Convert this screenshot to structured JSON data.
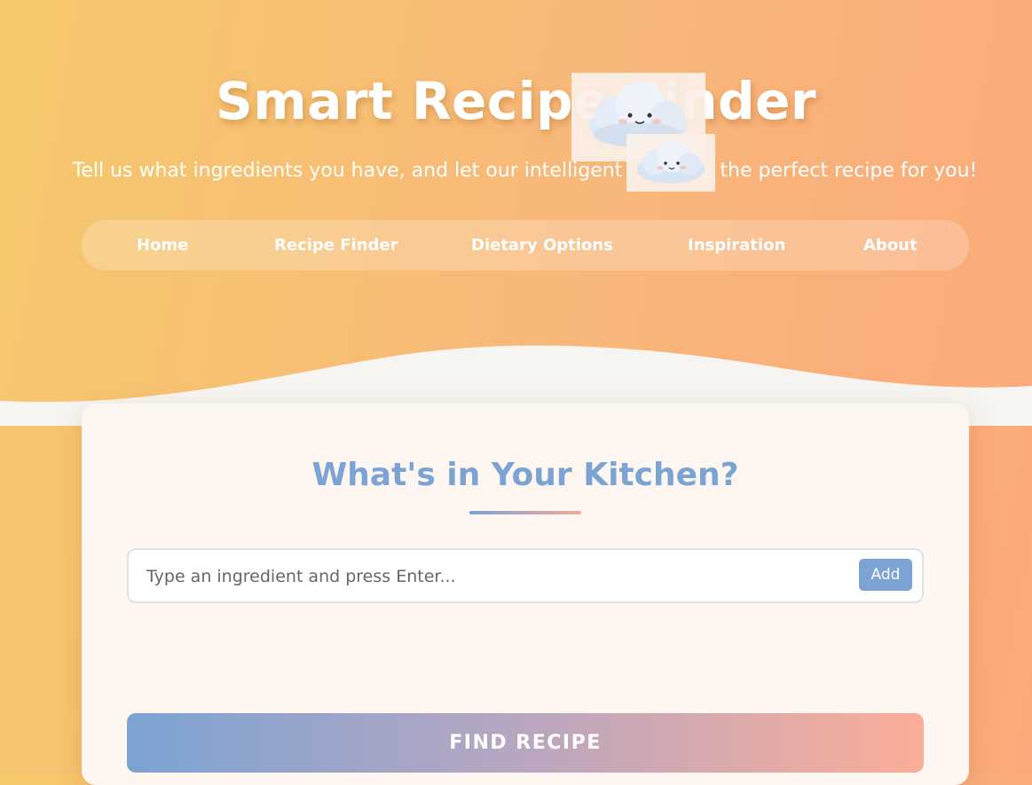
{
  "header": {
    "title": "Smart Recipe Finder",
    "subtitle": "Tell us what ingredients you have, and let our intelligent chef find the perfect recipe for you!"
  },
  "nav": {
    "items": [
      {
        "label": "Home"
      },
      {
        "label": "Recipe Finder"
      },
      {
        "label": "Dietary Options"
      },
      {
        "label": "Inspiration"
      },
      {
        "label": "About"
      }
    ]
  },
  "kitchen": {
    "title": "What's in Your Kitchen?",
    "input_placeholder": "Type an ingredient and press Enter...",
    "add_label": "Add",
    "find_label": "FIND RECIPE"
  },
  "colors": {
    "accent_blue": "#7ba3d3",
    "accent_peach": "#fbad97",
    "background_start": "#f6c96c",
    "background_end": "#fba97a"
  },
  "decorations": [
    "cloud-mascot-icon",
    "small-cloud-mascot-icon"
  ]
}
